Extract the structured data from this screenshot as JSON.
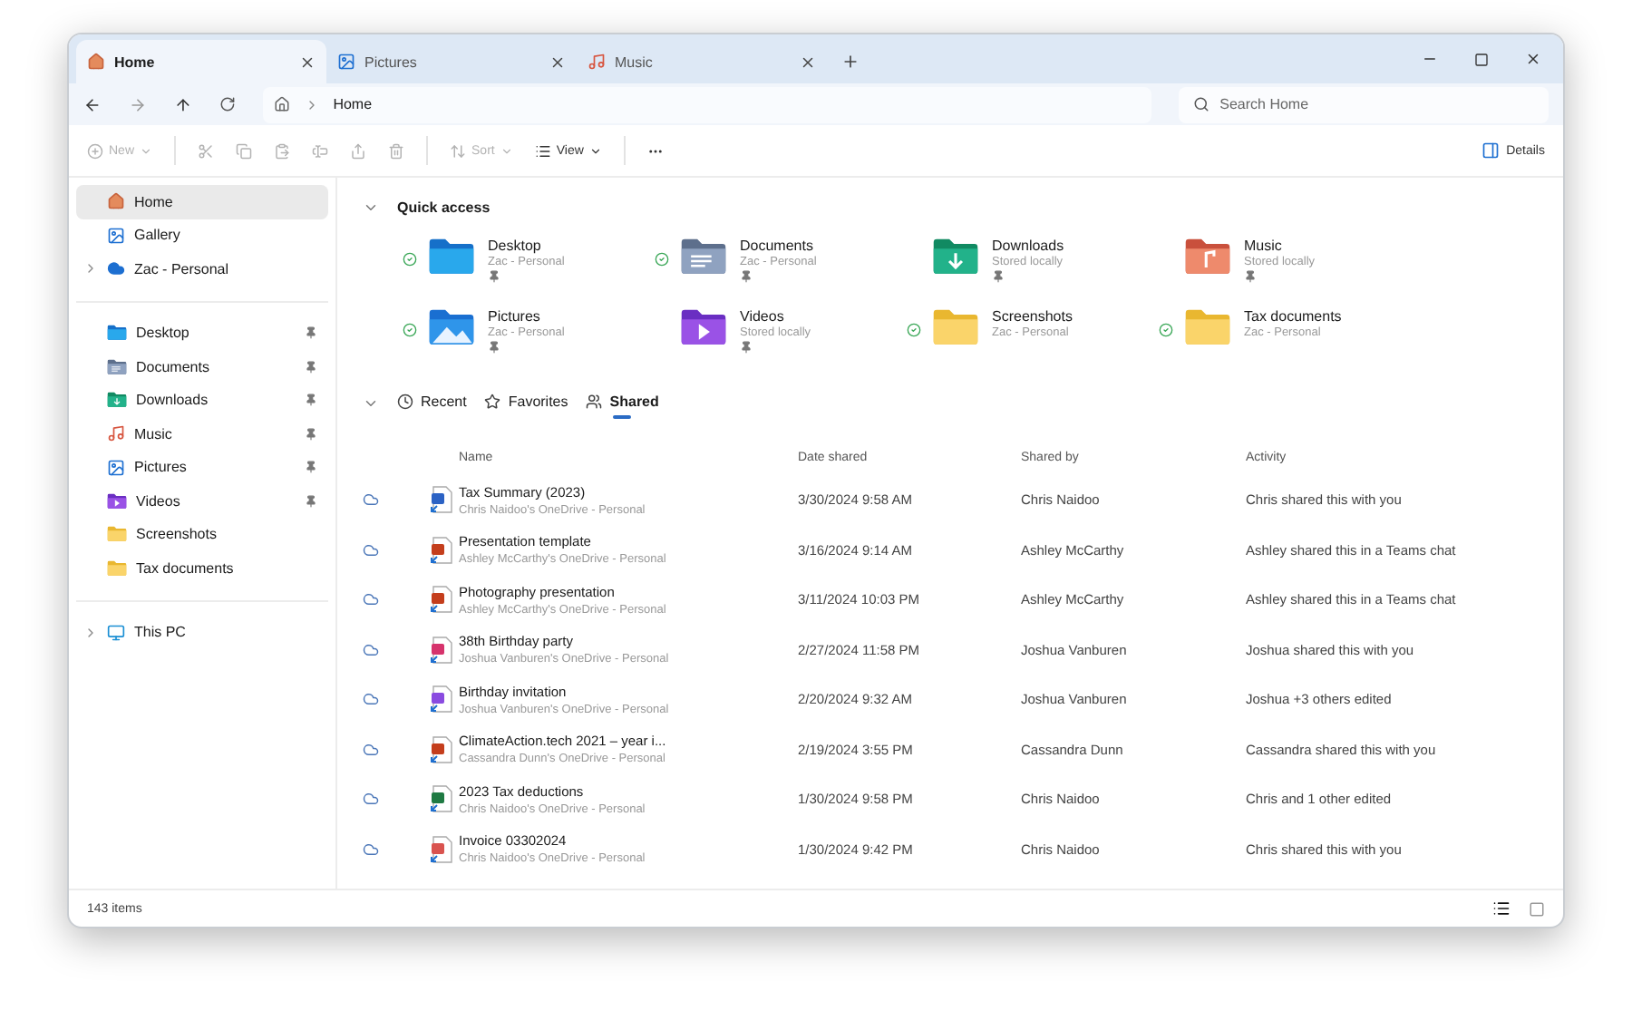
{
  "tabs": [
    {
      "label": "Home",
      "kind": "home",
      "selected": true
    },
    {
      "label": "Pictures",
      "kind": "pictures",
      "selected": false
    },
    {
      "label": "Music",
      "kind": "music",
      "selected": false
    }
  ],
  "address": {
    "crumbs": [
      "Home"
    ],
    "search_placeholder": "Search Home"
  },
  "toolbar": {
    "buttons": [
      {
        "kind": "new",
        "label": "New",
        "disabled": true,
        "menu": true
      },
      {
        "kind": "cut",
        "disabled": true
      },
      {
        "kind": "copy",
        "disabled": true
      },
      {
        "kind": "paste",
        "disabled": true
      },
      {
        "kind": "rename",
        "disabled": true
      },
      {
        "kind": "share",
        "disabled": true
      },
      {
        "kind": "delete",
        "disabled": true
      },
      {
        "kind": "sort",
        "label": "Sort",
        "disabled": true,
        "menu": true
      },
      {
        "kind": "view",
        "label": "View",
        "disabled": false,
        "menu": true
      },
      {
        "kind": "more",
        "disabled": false
      }
    ],
    "details_label": "Details"
  },
  "sidebar": {
    "groups": [
      [
        {
          "label": "Home",
          "kind": "home",
          "selected": true,
          "pinned": false
        },
        {
          "label": "Gallery",
          "kind": "pictures",
          "selected": false,
          "pinned": false
        },
        {
          "label": "Zac - Personal",
          "kind": "cloud",
          "selected": false,
          "pinned": false,
          "expanded": false
        }
      ],
      [
        {
          "label": "Desktop",
          "kind": "desktop",
          "selected": false,
          "pinned": true
        },
        {
          "label": "Documents",
          "kind": "documents",
          "selected": false,
          "pinned": true
        },
        {
          "label": "Downloads",
          "kind": "downloads",
          "selected": false,
          "pinned": true
        },
        {
          "label": "Music",
          "kind": "music",
          "selected": false,
          "pinned": true
        },
        {
          "label": "Pictures",
          "kind": "pictures",
          "selected": false,
          "pinned": true
        },
        {
          "label": "Videos",
          "kind": "videos",
          "selected": false,
          "pinned": true
        },
        {
          "label": "Screenshots",
          "kind": "folder",
          "selected": false,
          "pinned": false
        },
        {
          "label": "Tax documents",
          "kind": "folder",
          "selected": false,
          "pinned": false
        }
      ],
      [
        {
          "label": "This PC",
          "kind": "pc",
          "selected": false,
          "pinned": false,
          "expanded": false
        }
      ]
    ]
  },
  "quick_access": {
    "title": "Quick access",
    "expanded": true,
    "items": [
      {
        "name": "Desktop",
        "location": "Zac - Personal",
        "kind": "desktop",
        "synced": true,
        "pinned": true
      },
      {
        "name": "Documents",
        "location": "Zac - Personal",
        "kind": "documents",
        "synced": true,
        "pinned": true
      },
      {
        "name": "Downloads",
        "location": "Stored locally",
        "kind": "downloads",
        "synced": false,
        "pinned": true
      },
      {
        "name": "Music",
        "location": "Stored locally",
        "kind": "music",
        "synced": false,
        "pinned": true
      },
      {
        "name": "Pictures",
        "location": "Zac - Personal",
        "kind": "pictures",
        "synced": true,
        "pinned": true
      },
      {
        "name": "Videos",
        "location": "Stored locally",
        "kind": "videos",
        "synced": false,
        "pinned": true
      },
      {
        "name": "Screenshots",
        "location": "Zac - Personal",
        "kind": "folder",
        "synced": true,
        "pinned": false
      },
      {
        "name": "Tax documents",
        "location": "Zac - Personal",
        "kind": "folder",
        "synced": true,
        "pinned": false
      }
    ]
  },
  "file_tabs": [
    {
      "label": "Recent",
      "kind": "recent",
      "selected": false
    },
    {
      "label": "Favorites",
      "kind": "favorites",
      "selected": false
    },
    {
      "label": "Shared",
      "kind": "shared",
      "selected": true
    }
  ],
  "table": {
    "columns": [
      "Name",
      "Date shared",
      "Shared by",
      "Activity"
    ],
    "rows": [
      {
        "name": "Tax Summary (2023)",
        "location": "Chris Naidoo's OneDrive - Personal",
        "kind": "word",
        "date": "3/30/2024 9:58 AM",
        "shared_by": "Chris Naidoo",
        "activity": "Chris shared this with you"
      },
      {
        "name": "Presentation template",
        "location": "Ashley McCarthy's OneDrive - Personal",
        "kind": "powerpoint",
        "date": "3/16/2024 9:14 AM",
        "shared_by": "Ashley McCarthy",
        "activity": "Ashley shared this in a Teams chat"
      },
      {
        "name": "Photography presentation",
        "location": "Ashley McCarthy's OneDrive - Personal",
        "kind": "powerpoint",
        "date": "3/11/2024 10:03 PM",
        "shared_by": "Ashley McCarthy",
        "activity": "Ashley shared this in a Teams chat"
      },
      {
        "name": "38th Birthday party",
        "location": "Joshua Vanburen's OneDrive - Personal",
        "kind": "video",
        "date": "2/27/2024 11:58 PM",
        "shared_by": "Joshua Vanburen",
        "activity": "Joshua shared this with you"
      },
      {
        "name": "Birthday invitation",
        "location": "Joshua Vanburen's OneDrive - Personal",
        "kind": "design",
        "date": "2/20/2024 9:32 AM",
        "shared_by": "Joshua Vanburen",
        "activity": "Joshua +3 others edited"
      },
      {
        "name": "ClimateAction.tech 2021 – year i...",
        "location": "Cassandra Dunn's OneDrive - Personal",
        "kind": "powerpoint",
        "date": "2/19/2024 3:55 PM",
        "shared_by": "Cassandra Dunn",
        "activity": "Cassandra shared this with you"
      },
      {
        "name": "2023 Tax deductions",
        "location": "Chris Naidoo's OneDrive - Personal",
        "kind": "excel",
        "date": "1/30/2024 9:58 PM",
        "shared_by": "Chris Naidoo",
        "activity": "Chris and 1 other edited"
      },
      {
        "name": "Invoice 03302024",
        "location": "Chris Naidoo's OneDrive - Personal",
        "kind": "pdf",
        "date": "1/30/2024 9:42 PM",
        "shared_by": "Chris Naidoo",
        "activity": "Chris shared this with you"
      }
    ]
  },
  "status_bar": {
    "count": "143 items",
    "views": [
      {
        "kind": "details",
        "selected": true
      },
      {
        "kind": "tiles",
        "selected": false
      }
    ]
  }
}
